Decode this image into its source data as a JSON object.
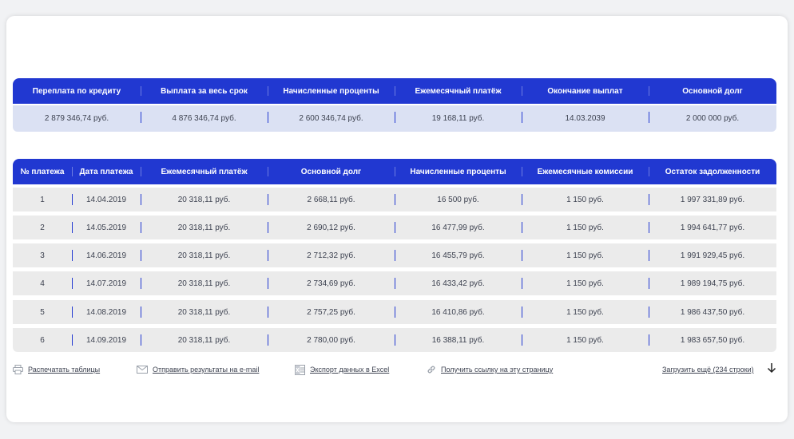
{
  "summary": {
    "headers": [
      "Переплата по кредиту",
      "Выплата за весь срок",
      "Начисленные проценты",
      "Ежемесячный платёж",
      "Окончание выплат",
      "Основной долг"
    ],
    "values": [
      "2 879 346,74 руб.",
      "4 876 346,74 руб.",
      "2 600 346,74 руб.",
      "19 168,11 руб.",
      "14.03.2039",
      "2 000 000 руб."
    ]
  },
  "schedule": {
    "headers": [
      "№ платежа",
      "Дата платежа",
      "Ежемесячный платёж",
      "Основной долг",
      "Начисленные проценты",
      "Ежемесячные комиссии",
      "Остаток задолженности"
    ],
    "rows": [
      [
        "1",
        "14.04.2019",
        "20 318,11 руб.",
        "2 668,11 руб.",
        "16 500 руб.",
        "1 150 руб.",
        "1 997 331,89 руб."
      ],
      [
        "2",
        "14.05.2019",
        "20 318,11 руб.",
        "2 690,12 руб.",
        "16 477,99 руб.",
        "1 150 руб.",
        "1 994 641,77 руб."
      ],
      [
        "3",
        "14.06.2019",
        "20 318,11 руб.",
        "2 712,32 руб.",
        "16 455,79 руб.",
        "1 150 руб.",
        "1 991 929,45 руб."
      ],
      [
        "4",
        "14.07.2019",
        "20 318,11 руб.",
        "2 734,69 руб.",
        "16 433,42 руб.",
        "1 150 руб.",
        "1 989 194,75 руб."
      ],
      [
        "5",
        "14.08.2019",
        "20 318,11 руб.",
        "2 757,25 руб.",
        "16 410,86 руб.",
        "1 150 руб.",
        "1 986 437,50 руб."
      ],
      [
        "6",
        "14.09.2019",
        "20 318,11 руб.",
        "2 780,00 руб.",
        "16 388,11 руб.",
        "1 150 руб.",
        "1 983 657,50 руб."
      ]
    ]
  },
  "footer": {
    "print": "Распечатать таблицы",
    "email": "Отправить результаты на e-mail",
    "excel": "Экспорт данных в Excel",
    "link": "Получить ссылку на эту страницу",
    "load_more": "Загрузить ещё (234 строки)"
  },
  "colors": {
    "accent": "#2138d1",
    "summary_bg": "#dbe1f3",
    "row_bg": "#ebebeb"
  },
  "icons": {
    "print": "printer-icon",
    "email": "envelope-icon",
    "excel": "excel-icon",
    "link": "link-icon",
    "load_more": "arrow-down-icon"
  }
}
